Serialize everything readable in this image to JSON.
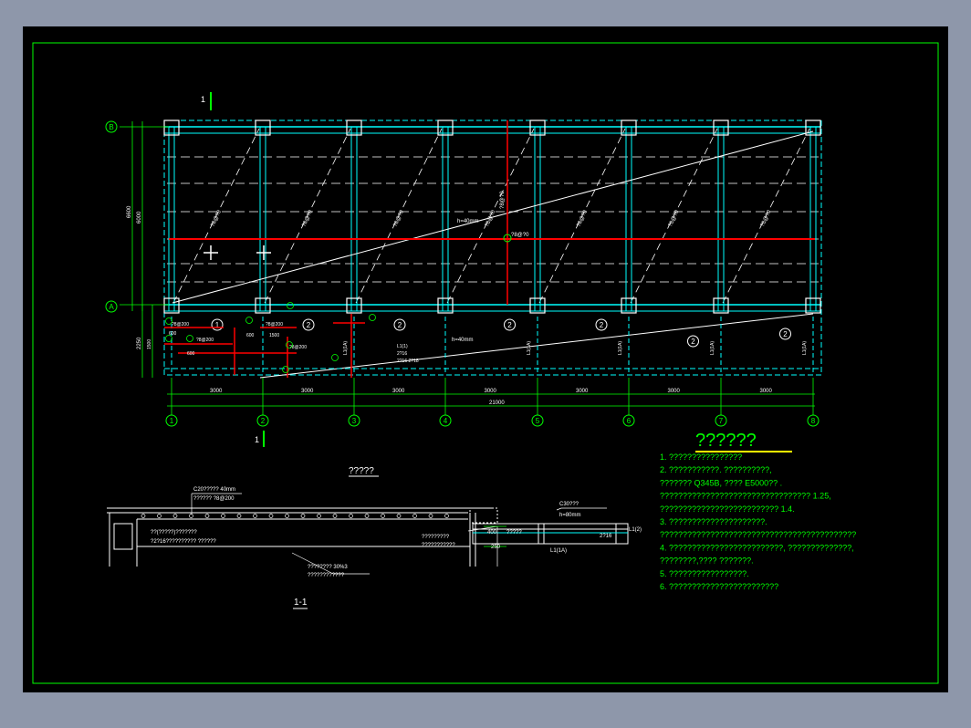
{
  "plan": {
    "section_marker_top": "1",
    "section_marker_bottom": "1",
    "row_labels": [
      "B",
      "A"
    ],
    "col_labels": [
      "1",
      "2",
      "3",
      "4",
      "5",
      "6",
      "7",
      "8"
    ],
    "span_dims": [
      "3000",
      "3000",
      "3000",
      "3000",
      "3000",
      "3000",
      "3000"
    ],
    "total_dim": "21000",
    "height_dims": [
      "6600",
      "6000"
    ],
    "cant_dims": [
      "2250",
      "1500"
    ],
    "bay_brace_label": "?8@?0",
    "center_tie_label": "?8@?0",
    "vert_tie_label": "?8@?0",
    "diag_tie_label": "h=40mm",
    "panel_marks": [
      "1",
      "2",
      "2",
      "2",
      "2",
      "2",
      "2",
      "1"
    ],
    "beam_label": "L1(1A)",
    "rebar_labels": [
      "?8@200",
      "?8@200",
      "?8@200",
      "?8@200",
      "?8@150",
      "?8@150"
    ],
    "dim_small": [
      "600",
      "600",
      "1500",
      "600"
    ],
    "note_texts": [
      "L1(1)",
      "2?16",
      "2?16 2?18",
      "h=40mm"
    ]
  },
  "section": {
    "plan_title": "?????",
    "title": "1-1",
    "concrete_note": "C20?????  40mm",
    "mesh_note": "??????  ?8@200",
    "left_notes": [
      "??(?????)???????",
      "?2?16??????????  ??????"
    ],
    "right_notes": [
      "?????????",
      "???????????"
    ],
    "slope_note": "????????  30%3",
    "slope_note2": "????????????",
    "dims": [
      "400",
      "250"
    ],
    "beam_label_1": "C30???",
    "beam_label_2": "h=80mm",
    "beam_label_3": "L1(1A)",
    "rebar_1": "?????",
    "rebar_2": "2?16",
    "rebar_3": "L1(2)"
  },
  "notes": {
    "title": "??????",
    "lines": [
      "1. ????????????????",
      "2. ???????????.   ??????????,",
      "    ???????  Q345B, ????  E5000??  .",
      "    ?????????????????????????????????         1.25,",
      "    ??????????????????????????              1.4.",
      "3. ?????????????????????.",
      "    ???????????????????????????????????????????",
      "4. ?????????????????????????,          ??????????????,",
      "    ????????,????     ???????.",
      "5. ?????????????????.",
      "6. ????????????????????????"
    ]
  },
  "colors": {
    "background": "#000000",
    "frame": "#00ff00",
    "grid": "#00ffff",
    "dash": "#ffffff",
    "red": "#ff0000",
    "yellow": "#ffff00"
  }
}
